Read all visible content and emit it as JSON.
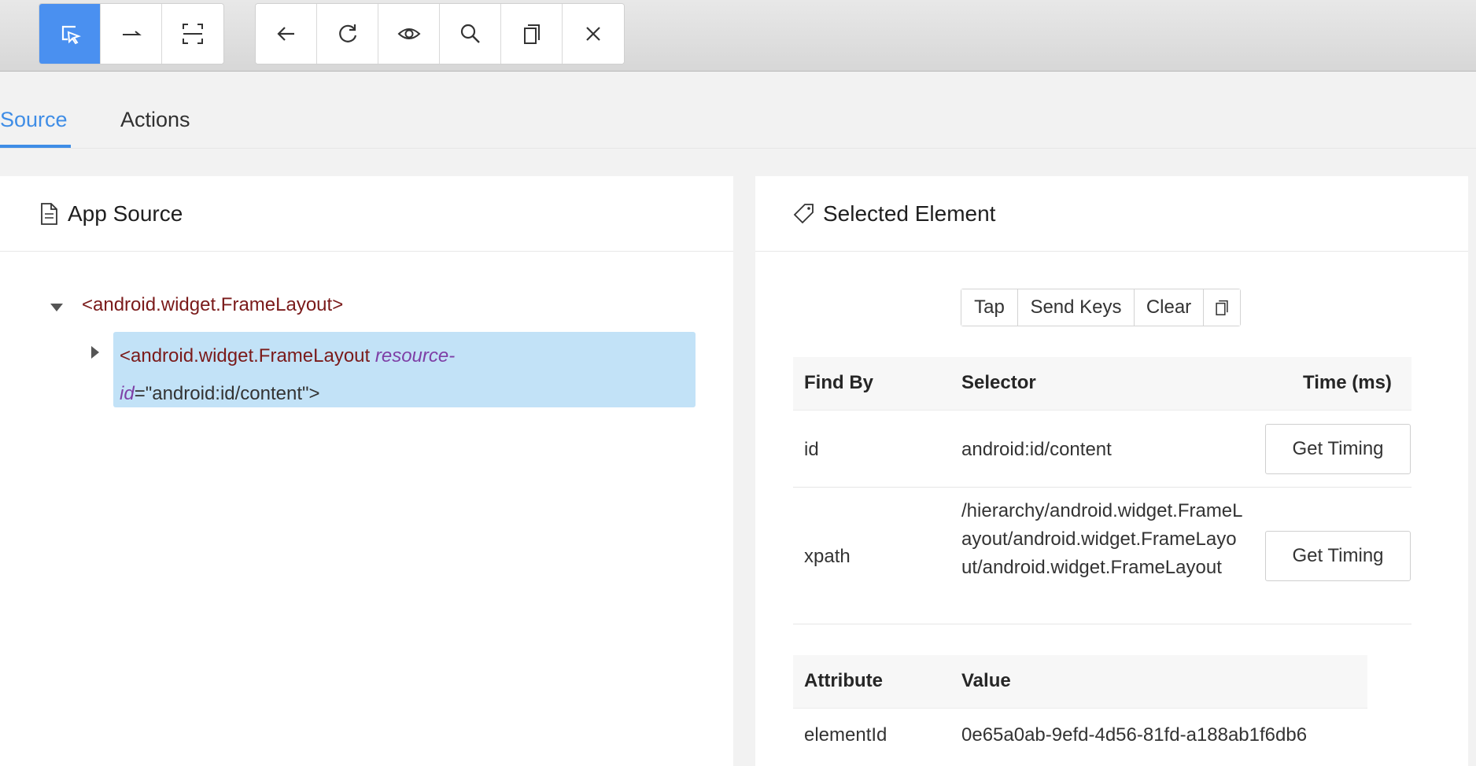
{
  "toolbar": {
    "group1": [
      {
        "icon": "select-element-icon",
        "active": true
      },
      {
        "icon": "swipe-arrow-icon",
        "active": false
      },
      {
        "icon": "tap-coordinates-icon",
        "active": false
      }
    ],
    "group2": [
      {
        "icon": "back-arrow-icon"
      },
      {
        "icon": "refresh-icon"
      },
      {
        "icon": "eye-icon"
      },
      {
        "icon": "search-icon"
      },
      {
        "icon": "copy-icon"
      },
      {
        "icon": "close-icon"
      }
    ]
  },
  "tabs": [
    {
      "label": "Source",
      "active": true
    },
    {
      "label": "Actions",
      "active": false
    }
  ],
  "app_source": {
    "title": "App Source",
    "root_node": "<android.widget.FrameLayout>",
    "child_tag": "<android.widget.FrameLayout",
    "child_attr_name_part1": "resource-",
    "child_attr_name_part2": "id",
    "child_attr_rest": "=\"android:id/content\">"
  },
  "selected_element": {
    "title": "Selected Element",
    "actions": [
      "Tap",
      "Send Keys",
      "Clear"
    ],
    "find_table": {
      "headers": [
        "Find By",
        "Selector",
        "Time (ms)"
      ],
      "rows": [
        {
          "find_by": "id",
          "selector": "android:id/content",
          "button": "Get Timing"
        },
        {
          "find_by": "xpath",
          "selector": "/hierarchy/android.widget.FrameLayout/android.widget.FrameLayout/android.widget.FrameLayout",
          "button": "Get Timing"
        }
      ]
    },
    "attr_table": {
      "headers": [
        "Attribute",
        "Value"
      ],
      "rows": [
        {
          "name": "elementId",
          "value": "0e65a0ab-9efd-4d56-81fd-a188ab1f6db6"
        }
      ]
    }
  },
  "colors": {
    "accent": "#3f8de6",
    "active_button": "#4a90f0",
    "selection": "#c2e2f7",
    "xml_tag": "#7a1a1a",
    "xml_attr": "#7e3fa6"
  }
}
